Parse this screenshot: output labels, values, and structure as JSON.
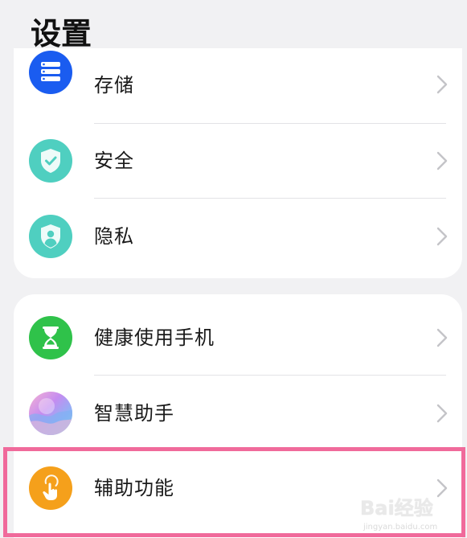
{
  "header": {
    "title": "设置"
  },
  "group1": {
    "items": [
      {
        "label": "存储",
        "icon": "storage-icon",
        "color": "#1a5cf0"
      },
      {
        "label": "安全",
        "icon": "shield-check-icon",
        "color": "#4fcfc0"
      },
      {
        "label": "隐私",
        "icon": "privacy-shield-icon",
        "color": "#4fcfc0"
      }
    ]
  },
  "group2": {
    "items": [
      {
        "label": "健康使用手机",
        "icon": "hourglass-icon",
        "color": "#2fc24a"
      },
      {
        "label": "智慧助手",
        "icon": "smart-assistant-icon",
        "color": "#c58cf0"
      },
      {
        "label": "辅助功能",
        "icon": "accessibility-hand-icon",
        "color": "#f5a01b"
      }
    ]
  },
  "highlight": {
    "color": "#f06a9b",
    "target": "辅助功能"
  },
  "watermark": {
    "logo": "Bai经验",
    "sub": "jingyan.baidu.com"
  }
}
